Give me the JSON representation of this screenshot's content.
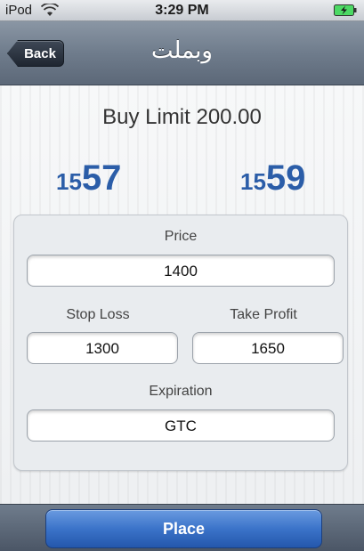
{
  "status_bar": {
    "carrier": "iPod",
    "time": "3:29 PM"
  },
  "nav": {
    "back_label": "Back",
    "title": "وبملت"
  },
  "order": {
    "title": "Buy Limit 200.00",
    "bid": {
      "small": "15",
      "big": "57"
    },
    "ask": {
      "small": "15",
      "big": "59"
    }
  },
  "form": {
    "price_label": "Price",
    "price_value": "1400",
    "stop_loss_label": "Stop Loss",
    "stop_loss_value": "1300",
    "take_profit_label": "Take Profit",
    "take_profit_value": "1650",
    "expiration_label": "Expiration",
    "expiration_value": "GTC"
  },
  "toolbar": {
    "place_label": "Place"
  },
  "colors": {
    "quote_blue": "#2b5da8",
    "place_button": "#3b73c9"
  }
}
